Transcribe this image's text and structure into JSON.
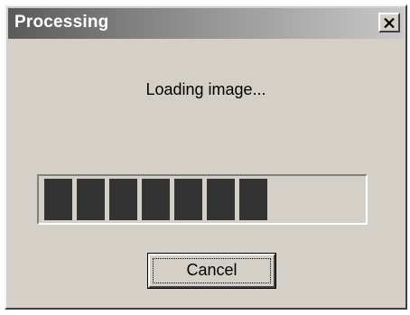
{
  "dialog": {
    "title": "Processing",
    "message": "Loading image...",
    "progress": {
      "value": 0.6,
      "segments_filled": 7
    },
    "cancel_label": "Cancel"
  },
  "icons": {
    "close": "close-icon"
  },
  "colors": {
    "face": "#d4d0c8",
    "progress_fill": "#333333"
  }
}
